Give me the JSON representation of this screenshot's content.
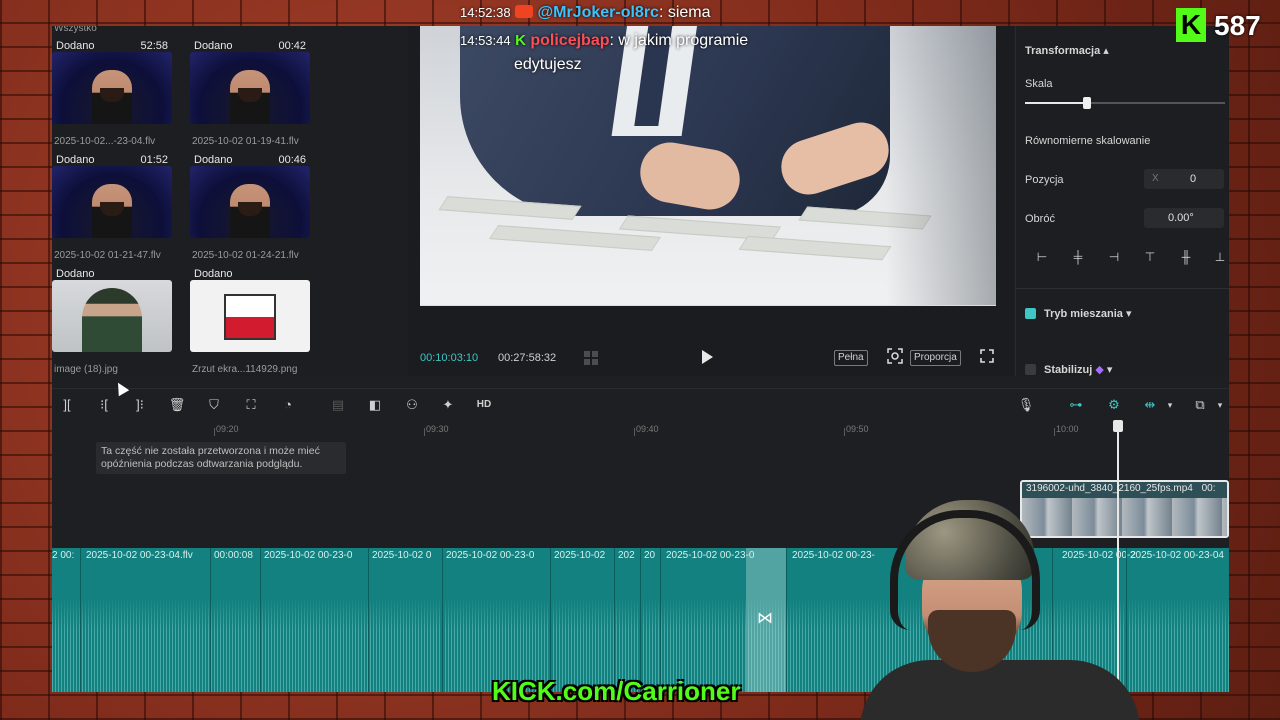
{
  "media": {
    "label": "Wszystko",
    "items": [
      {
        "tag": "Dodano",
        "duration": "52:58",
        "name": "2025-10-02...-23-04.flv"
      },
      {
        "tag": "Dodano",
        "duration": "00:42",
        "name": "2025-10-02 01-19-41.flv"
      },
      {
        "tag": "Dodano",
        "duration": "01:52",
        "name": "2025-10-02 01-21-47.flv"
      },
      {
        "tag": "Dodano",
        "duration": "00:46",
        "name": "2025-10-02 01-24-21.flv"
      },
      {
        "tag": "Dodano",
        "duration": "",
        "name": "image (18).jpg"
      },
      {
        "tag": "Dodano",
        "duration": "",
        "name": "Zrzut ekra...114929.png"
      }
    ]
  },
  "preview": {
    "current_time": "00:10:03:10",
    "total_time": "00:27:58:32",
    "btn_full": "Pełna",
    "btn_ratio": "Proporcja"
  },
  "props": {
    "section": "Transformacja",
    "scale_label": "Skala",
    "scale_level": 0.31,
    "uniform_label": "Równomierne skalowanie",
    "position_label": "Pozycja",
    "pos_x_label": "X",
    "pos_x_value": "0",
    "rotate_label": "Obróć",
    "rotate_value": "0.00°",
    "blend_label": "Tryb mieszania",
    "blend_checked": true,
    "stabilize_label": "Stabilizuj",
    "stabilize_checked": false
  },
  "timeline": {
    "ticks": [
      "09:20",
      "09:30",
      "09:40",
      "09:50",
      "10:00"
    ],
    "notice": "Ta część nie została przetworzona i może mieć opóźnienia podczas odtwarzania podglądu.",
    "overlay_clip": "3196002-uhd_3840_2160_25fps.mp4",
    "overlay_clip_suffix": "00:",
    "segments": [
      "2 00:",
      "2025-10-02 00-23-04.flv",
      "00:00:08",
      "2025-10-02 00-23-0",
      "2025-10-02 0",
      "2025-10-02 00-23-0",
      "2025-10-02",
      "202",
      "20",
      "2025-10-02 00-23-0",
      "2025-10-02 00-23-",
      "2025-10-02 00-2",
      "2025-10-02 00-23-04"
    ]
  },
  "stream": {
    "chat1_time": "14:52:38",
    "chat1_user": "@MrJoker-ol8rc",
    "chat1_msg": ": siema",
    "chat2_time": "14:53:44",
    "chat2_user": "policejbap",
    "chat2_msg": ": w jakim programie",
    "chat2_msg2": "edytujesz",
    "viewer_count": "587",
    "kick_url": "KICK.com/Carrioner",
    "colors": {
      "kick_green": "#53fc18",
      "accent_teal": "#3fc6c4"
    }
  }
}
